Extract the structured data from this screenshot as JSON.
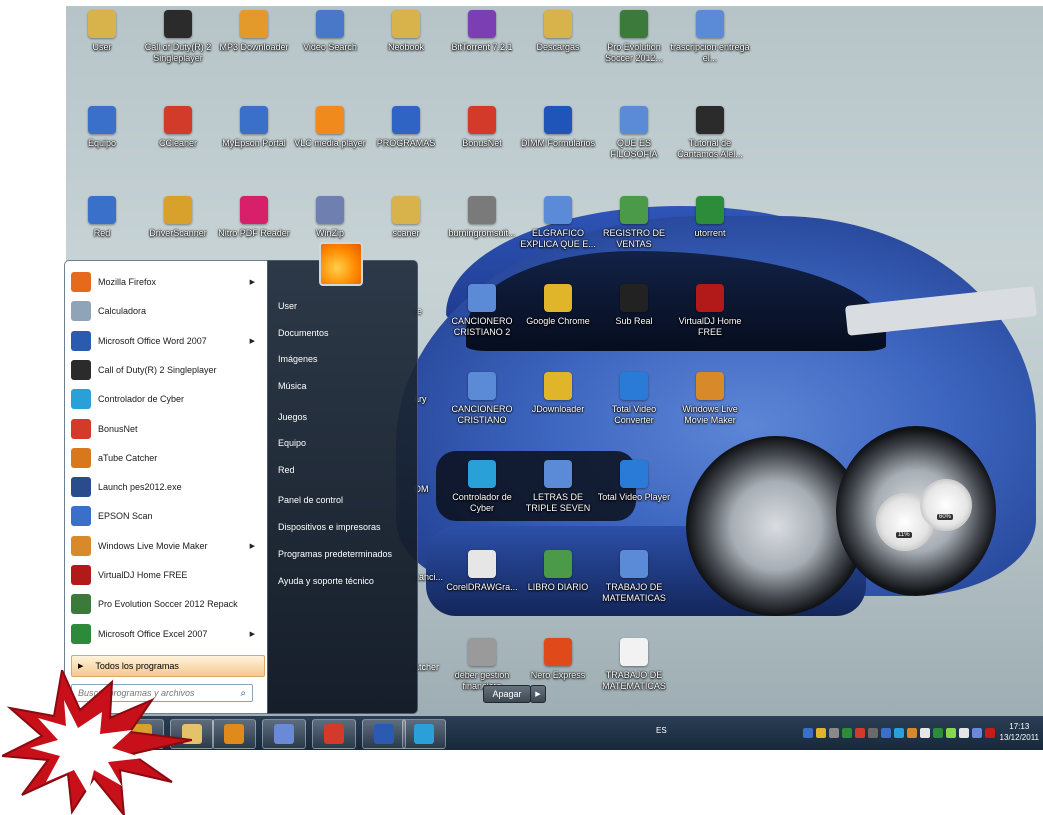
{
  "desktop_icons": [
    {
      "label": "User",
      "color": "#d8b24a"
    },
    {
      "label": "Call of Duty(R) 2 Singleplayer",
      "color": "#2b2b2b"
    },
    {
      "label": "MP3 Downloader",
      "color": "#e39a2b"
    },
    {
      "label": "Video Search",
      "color": "#4a78c8"
    },
    {
      "label": "Neobook",
      "color": "#d8b24a"
    },
    {
      "label": "BitTorrent 7.2.1",
      "color": "#7b3fb3"
    },
    {
      "label": "Descargas",
      "color": "#d8b24a"
    },
    {
      "label": "Pro Evolution Soccer 2012...",
      "color": "#3c7a3c"
    },
    {
      "label": "trascripcion entrega el...",
      "color": "#5b8bd6"
    },
    {
      "label": "Equipo",
      "color": "#3a70c9"
    },
    {
      "label": "CCleaner",
      "color": "#d23a2a"
    },
    {
      "label": "MyEpson Portal",
      "color": "#3a70c9"
    },
    {
      "label": "VLC media player",
      "color": "#f08a1c"
    },
    {
      "label": "PROGRAMAS",
      "color": "#2f64c4"
    },
    {
      "label": "BonusNet",
      "color": "#d33a2a"
    },
    {
      "label": "DIMM Formularios",
      "color": "#1f55b8"
    },
    {
      "label": "QUE ES FILOSOFIA",
      "color": "#5b8bd6"
    },
    {
      "label": "Tutorial de Cantamos Alel...",
      "color": "#2b2b2b"
    },
    {
      "label": "Red",
      "color": "#3a70c9"
    },
    {
      "label": "DriverScanner",
      "color": "#d8a12b"
    },
    {
      "label": "Nitro PDF Reader",
      "color": "#d81f6a"
    },
    {
      "label": "WinZip",
      "color": "#6f7fb0"
    },
    {
      "label": "scaner",
      "color": "#d8b24a"
    },
    {
      "label": "burningromsuit...",
      "color": "#7a7a7a"
    },
    {
      "label": "ELGRAFICO EXPLICA QUE E...",
      "color": "#5b8bd6"
    },
    {
      "label": "REGISTRO DE VENTAS",
      "color": "#4a9a4a"
    },
    {
      "label": "utorrent",
      "color": "#2c8c3a"
    },
    {
      "label": "CANCIONERO CRISTIANO 2",
      "color": "#5b8bd6"
    },
    {
      "label": "Google Chrome",
      "color": "#e0b52a"
    },
    {
      "label": "Sub Real",
      "color": "#222222"
    },
    {
      "label": "VirtualDJ Home FREE",
      "color": "#b21a1a"
    },
    {
      "label": "CANCIONERO CRISTIANO",
      "color": "#5b8bd6"
    },
    {
      "label": "JDownloader",
      "color": "#e0b52a"
    },
    {
      "label": "Total Video Converter",
      "color": "#2a7ad8"
    },
    {
      "label": "Windows Live Movie Maker",
      "color": "#d88a2a"
    },
    {
      "label": "Controlador de Cyber",
      "color": "#2aa0d8"
    },
    {
      "label": "LETRAS DE TRIPLE SEVEN",
      "color": "#5b8bd6"
    },
    {
      "label": "Total Video Player",
      "color": "#2a7ad8"
    },
    {
      "label": "CorelDRAWGra...",
      "color": "#e6e6e6"
    },
    {
      "label": "LIBRO DIARIO",
      "color": "#4a9a4a"
    },
    {
      "label": "TRABAJO DE MATEMATICAS",
      "color": "#5b8bd6"
    },
    {
      "label": "deber gestion financiera",
      "color": "#9a9a9a"
    },
    {
      "label": "Nero Express",
      "color": "#e04a1a"
    },
    {
      "label": "TRABAJO DE MATEMATICAS",
      "color": "#f2f2f2"
    }
  ],
  "partial_labels": [
    "re",
    "ary",
    "OM",
    "nanci...",
    "atcher"
  ],
  "start_menu": {
    "programs": [
      {
        "label": "Mozilla Firefox",
        "color": "#e56a1c",
        "has_arrow": true
      },
      {
        "label": "Calculadora",
        "color": "#8fa4b8",
        "has_arrow": false
      },
      {
        "label": "Microsoft Office Word 2007",
        "color": "#2a5bb0",
        "has_arrow": true
      },
      {
        "label": "Call of Duty(R) 2 Singleplayer",
        "color": "#2b2b2b",
        "has_arrow": false
      },
      {
        "label": "Controlador de Cyber",
        "color": "#2aa0d8",
        "has_arrow": false
      },
      {
        "label": "BonusNet",
        "color": "#d33a2a",
        "has_arrow": false
      },
      {
        "label": "aTube Catcher",
        "color": "#d8771c",
        "has_arrow": false
      },
      {
        "label": "Launch pes2012.exe",
        "color": "#2b4c8c",
        "has_arrow": false
      },
      {
        "label": "EPSON Scan",
        "color": "#3a70c9",
        "has_arrow": false
      },
      {
        "label": "Windows Live Movie Maker",
        "color": "#d88a2a",
        "has_arrow": true
      },
      {
        "label": "VirtualDJ Home FREE",
        "color": "#b21a1a",
        "has_arrow": false
      },
      {
        "label": "Pro Evolution Soccer 2012 Repack",
        "color": "#3c7a3c",
        "has_arrow": false
      },
      {
        "label": "Microsoft Office Excel 2007",
        "color": "#2c8a3a",
        "has_arrow": true
      }
    ],
    "all_programs": "Todos los programas",
    "search_placeholder": "Buscar programas y archivos",
    "right_items": [
      "User",
      "Documentos",
      "Imágenes",
      "Música",
      "Juegos",
      "Equipo",
      "Red",
      "Panel de control",
      "Dispositivos e impresoras",
      "Programas predeterminados",
      "Ayuda y soporte técnico"
    ],
    "shutdown": "Apagar"
  },
  "taskbar": {
    "pinned": [
      {
        "name": "chrome",
        "color": "#d8a12b"
      },
      {
        "name": "explorer",
        "color": "#e3c26a"
      },
      {
        "name": "media-player",
        "color": "#e08a1c"
      },
      {
        "name": "paint",
        "color": "#6a8ad8"
      },
      {
        "name": "bonusnet",
        "color": "#d33a2a"
      },
      {
        "name": "word",
        "color": "#2a5bb0"
      },
      {
        "name": "cyber-controller",
        "color": "#2aa0d8"
      }
    ],
    "language": "ES",
    "time": "17:13",
    "date": "13/12/2011"
  },
  "gadgets": {
    "cpu": "11%",
    "memory": "60%"
  },
  "burst_color": "#c8101a"
}
